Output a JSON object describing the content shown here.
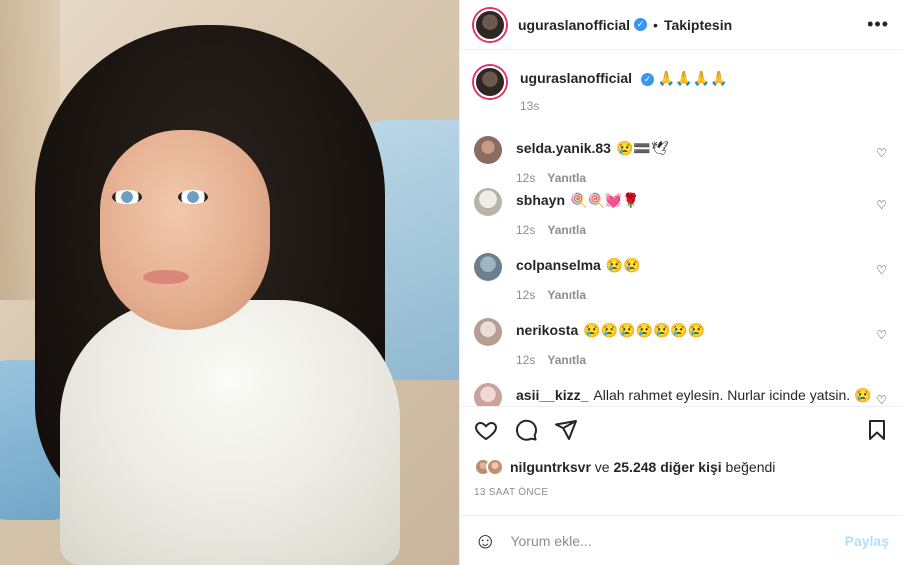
{
  "post": {
    "username": "uguraslanofficial",
    "verified_icon": "verified-badge-icon",
    "dot": "•",
    "follow_status": "Takiptesin",
    "more_icon": "•••"
  },
  "caption": {
    "username": "uguraslanofficial",
    "text": "🙏🙏🙏🙏",
    "time": "13s"
  },
  "comments": [
    {
      "username": "selda.yanik.83",
      "text": "😢🟰🕊",
      "time": "12s",
      "reply": "Yanıtla"
    },
    {
      "username": "sbhayn",
      "text": "🍭🍭💓🌹",
      "time": "12s",
      "reply": "Yanıtla"
    },
    {
      "username": "colpanselma",
      "text": "😢😢",
      "time": "12s",
      "reply": "Yanıtla"
    },
    {
      "username": "nerikosta",
      "text": "😢😢😢😢😢😢😢",
      "time": "12s",
      "reply": "Yanıtla"
    },
    {
      "username": "asii__kizz_",
      "text": "Allah rahmet eylesin. Nurlar icinde yatsin. 😢",
      "time": "",
      "reply": ""
    }
  ],
  "likes": {
    "first_user": "nilguntrksvr",
    "rest": " ve ",
    "count_text": "25.248 diğer kişi",
    "suffix": " beğendi"
  },
  "timestamp": "13 SAAT ÖNCE",
  "add_comment": {
    "placeholder": "Yorum ekle...",
    "post_label": "Paylaş"
  },
  "colors": {
    "accent": "#3897f0",
    "post_disabled": "#b2dffc",
    "muted": "#8e8e8e"
  }
}
